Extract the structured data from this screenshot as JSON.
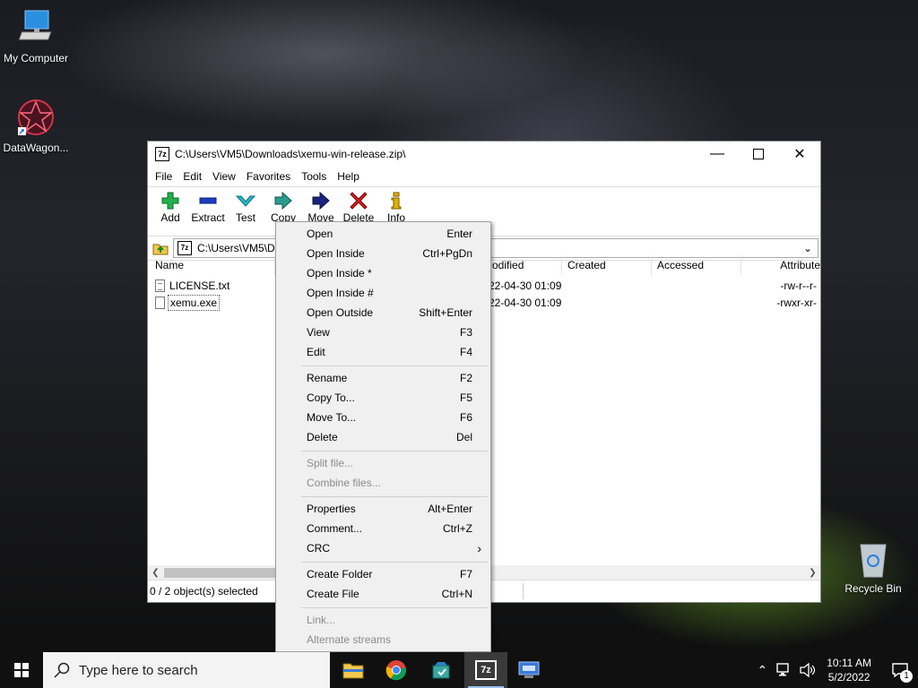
{
  "desktop": {
    "icons": [
      {
        "label": "My Computer"
      },
      {
        "label": "DataWagon..."
      },
      {
        "label": "Recycle Bin"
      }
    ]
  },
  "window": {
    "title": "C:\\Users\\VM5\\Downloads\\xemu-win-release.zip\\",
    "title_icon_text": "7z",
    "menu": [
      "File",
      "Edit",
      "View",
      "Favorites",
      "Tools",
      "Help"
    ],
    "toolbar": [
      {
        "label": "Add",
        "icon": "plus-icon",
        "color": "#22b14c"
      },
      {
        "label": "Extract",
        "icon": "minus-icon",
        "color": "#1f3fbf"
      },
      {
        "label": "Test",
        "icon": "check-icon",
        "color": "#2cb7c9"
      },
      {
        "label": "Copy",
        "icon": "copy-arrow-icon",
        "color": "#2a9d8f"
      },
      {
        "label": "Move",
        "icon": "move-arrow-icon",
        "color": "#1a237e"
      },
      {
        "label": "Delete",
        "icon": "x-icon",
        "color": "#d62020"
      },
      {
        "label": "Info",
        "icon": "info-icon",
        "color": "#e0b000"
      }
    ],
    "address": "C:\\Users\\VM5\\D",
    "columns": [
      "Name",
      "odified",
      "Created",
      "Accessed",
      "Attribute"
    ],
    "files": [
      {
        "name": "LICENSE.txt",
        "modified": "22-04-30 01:09",
        "attributes": "-rw-r--r-"
      },
      {
        "name": "xemu.exe",
        "modified": "22-04-30 01:09",
        "attributes": "-rwxr-xr-"
      }
    ],
    "status": "0 / 2 object(s) selected"
  },
  "context_menu": {
    "items": [
      {
        "label": "Open",
        "shortcut": "Enter",
        "disabled": false
      },
      {
        "label": "Open Inside",
        "shortcut": "Ctrl+PgDn",
        "disabled": false
      },
      {
        "label": "Open Inside *",
        "shortcut": "",
        "disabled": false
      },
      {
        "label": "Open Inside #",
        "shortcut": "",
        "disabled": false
      },
      {
        "label": "Open Outside",
        "shortcut": "Shift+Enter",
        "disabled": false
      },
      {
        "label": "View",
        "shortcut": "F3",
        "disabled": false
      },
      {
        "label": "Edit",
        "shortcut": "F4",
        "disabled": false
      },
      {
        "label": "Rename",
        "shortcut": "F2",
        "disabled": false
      },
      {
        "label": "Copy To...",
        "shortcut": "F5",
        "disabled": false
      },
      {
        "label": "Move To...",
        "shortcut": "F6",
        "disabled": false
      },
      {
        "label": "Delete",
        "shortcut": "Del",
        "disabled": false
      },
      {
        "label": "Split file...",
        "shortcut": "",
        "disabled": true
      },
      {
        "label": "Combine files...",
        "shortcut": "",
        "disabled": true
      },
      {
        "label": "Properties",
        "shortcut": "Alt+Enter",
        "disabled": false
      },
      {
        "label": "Comment...",
        "shortcut": "Ctrl+Z",
        "disabled": false
      },
      {
        "label": "CRC",
        "shortcut": "›",
        "disabled": false
      },
      {
        "label": "Create Folder",
        "shortcut": "F7",
        "disabled": false
      },
      {
        "label": "Create File",
        "shortcut": "Ctrl+N",
        "disabled": false
      },
      {
        "label": "Link...",
        "shortcut": "",
        "disabled": true
      },
      {
        "label": "Alternate streams",
        "shortcut": "",
        "disabled": true
      }
    ]
  },
  "taskbar": {
    "search_placeholder": "Type here to search",
    "apps": [
      "file-explorer-icon",
      "chrome-icon",
      "datawagon-icon",
      "7zip-icon",
      "rdp-icon"
    ],
    "time": "10:11 AM",
    "date": "5/2/2022",
    "notification_count": "1"
  }
}
